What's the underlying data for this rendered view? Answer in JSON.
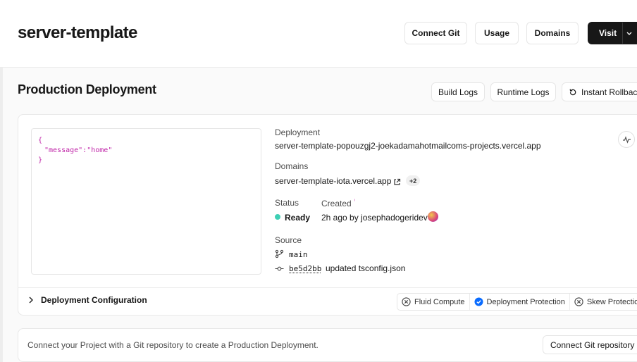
{
  "header": {
    "project_name": "server-template",
    "buttons": {
      "connect_git": "Connect Git",
      "usage": "Usage",
      "domains": "Domains",
      "visit": "Visit"
    }
  },
  "production": {
    "title": "Production Deployment",
    "actions": {
      "build_logs": "Build Logs",
      "runtime_logs": "Runtime Logs",
      "instant_rollback": "Instant Rollback"
    }
  },
  "preview": {
    "open_brace": "{",
    "key": "\"message\":",
    "value": "\"home\"",
    "close_brace": "}"
  },
  "deployment": {
    "label": "Deployment",
    "url": "server-template-popouzgj2-joekadamahotmailcoms-projects.vercel.app"
  },
  "domains": {
    "label": "Domains",
    "primary": "server-template-iota.vercel.app",
    "extra_count": "+2"
  },
  "status": {
    "label": "Status",
    "value": "Ready",
    "color": "#3ecfb4"
  },
  "created": {
    "label": "Created",
    "value": "2h ago by josephadogeridev"
  },
  "source": {
    "label": "Source",
    "branch": "main",
    "commit_hash": "be5d2bb",
    "commit_message": "updated tsconfig.json"
  },
  "config": {
    "label": "Deployment Configuration",
    "features": [
      {
        "label": "Fluid Compute",
        "enabled": false
      },
      {
        "label": "Deployment Protection",
        "enabled": true
      },
      {
        "label": "Skew Protection",
        "enabled": false
      }
    ]
  },
  "git_prompt": {
    "text": "Connect your Project with a Git repository to create a Production Deployment.",
    "button": "Connect Git repository"
  },
  "colors": {
    "accent_blue": "#0a6cff",
    "dark": "#171717"
  }
}
